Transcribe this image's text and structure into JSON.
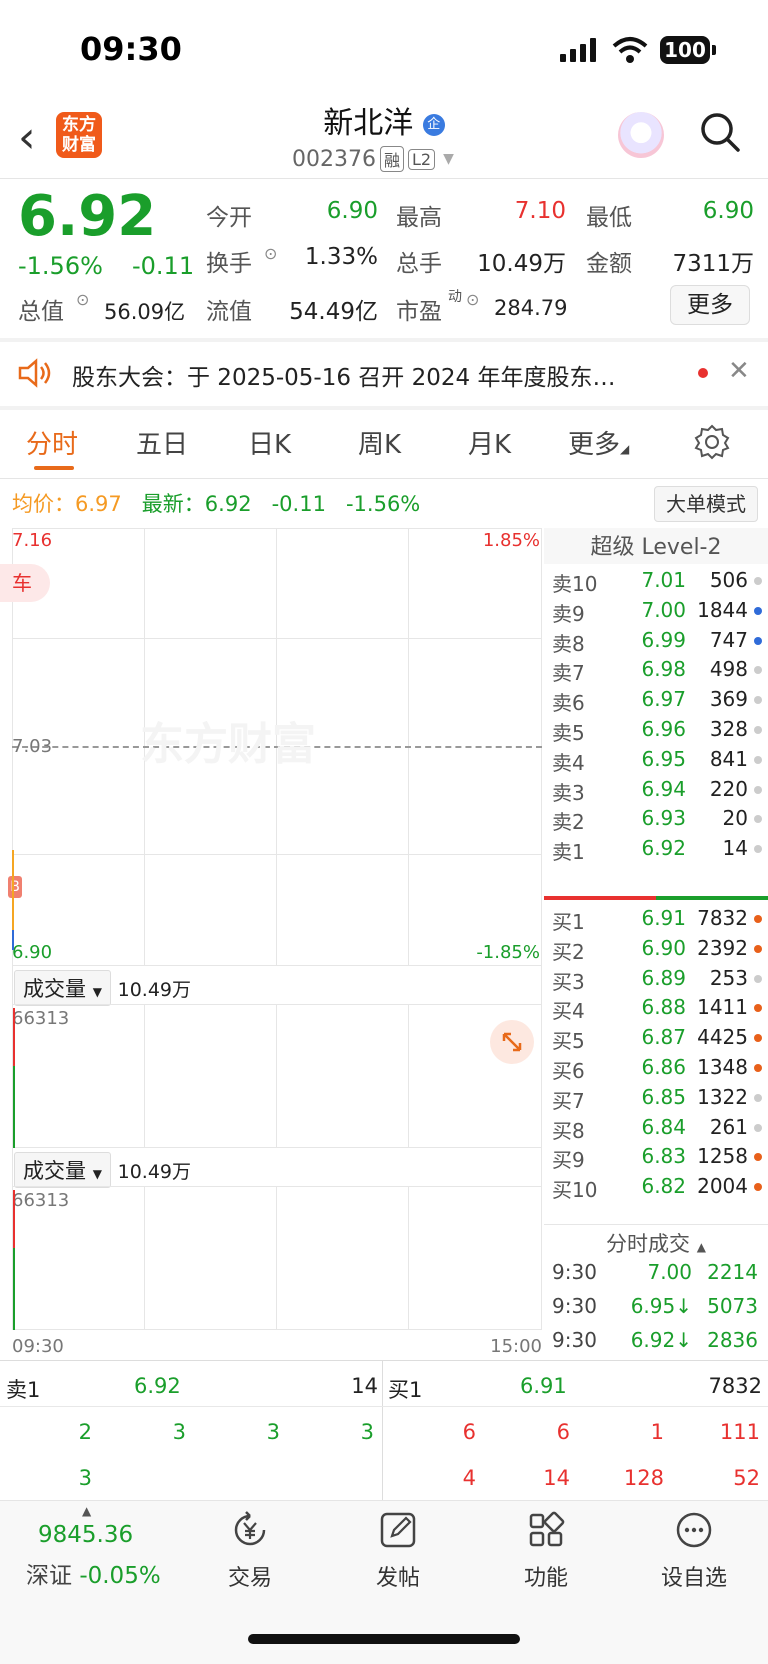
{
  "status_bar": {
    "time": "09:30",
    "battery": "100"
  },
  "header": {
    "logo_text": "东方\n财富",
    "stock_name": "新北洋",
    "name_badge": "企",
    "stock_code": "002376",
    "tags": [
      "融",
      "L2"
    ]
  },
  "quote": {
    "price": "6.92",
    "change_pct": "-1.56%",
    "change_abs": "-0.11",
    "fields": {
      "open_label": "今开",
      "open": "6.90",
      "high_label": "最高",
      "high": "7.10",
      "low_label": "最低",
      "low": "6.90",
      "turnover_label": "换手",
      "turnover": "1.33%",
      "volume_label": "总手",
      "volume": "10.49万",
      "amount_label": "金额",
      "amount": "7311万",
      "mktcap_label": "总值",
      "mktcap": "56.09亿",
      "float_label": "流值",
      "float": "54.49亿",
      "pe_label": "市盈",
      "pe_sup": "动",
      "pe": "284.79"
    },
    "more_button": "更多"
  },
  "notice": {
    "text": "股东大会：于 2025-05-16 召开 2024 年年度股东…"
  },
  "tabs": [
    "分时",
    "五日",
    "日K",
    "周K",
    "月K",
    "更多"
  ],
  "info_line": {
    "avg_label": "均价：",
    "avg": "6.97",
    "latest_label": "最新：",
    "latest": "6.92",
    "latest_abs": "-0.11",
    "latest_pct": "-1.56%",
    "big_order_button": "大单模式"
  },
  "chart": {
    "y_top": "7.16",
    "y_top_pct": "1.85%",
    "y_mid": "7.03",
    "y_bottom": "6.90",
    "y_bottom_pct": "-1.85%",
    "watermark": "东方财富",
    "bubble_text": "车",
    "b_marker": "B",
    "volume_panel_1": {
      "selector": "成交量",
      "value": "10.49万",
      "max": "66313"
    },
    "volume_panel_2": {
      "selector": "成交量",
      "value": "10.49万",
      "max": "66313"
    },
    "x_start": "09:30",
    "x_end": "15:00"
  },
  "order_book": {
    "title": "超级 Level-2",
    "asks": [
      {
        "label": "卖10",
        "price": "7.01",
        "vol": "506",
        "dot": "#cccccc"
      },
      {
        "label": "卖9",
        "price": "7.00",
        "vol": "1844",
        "dot": "#2f6bd8"
      },
      {
        "label": "卖8",
        "price": "6.99",
        "vol": "747",
        "dot": "#2f6bd8"
      },
      {
        "label": "卖7",
        "price": "6.98",
        "vol": "498",
        "dot": "#cccccc"
      },
      {
        "label": "卖6",
        "price": "6.97",
        "vol": "369",
        "dot": "#cccccc"
      },
      {
        "label": "卖5",
        "price": "6.96",
        "vol": "328",
        "dot": "#cccccc"
      },
      {
        "label": "卖4",
        "price": "6.95",
        "vol": "841",
        "dot": "#cccccc"
      },
      {
        "label": "卖3",
        "price": "6.94",
        "vol": "220",
        "dot": "#cccccc"
      },
      {
        "label": "卖2",
        "price": "6.93",
        "vol": "20",
        "dot": "#cccccc"
      },
      {
        "label": "卖1",
        "price": "6.92",
        "vol": "14",
        "dot": "#cccccc"
      }
    ],
    "bids": [
      {
        "label": "买1",
        "price": "6.91",
        "vol": "7832",
        "dot": "#e8601a"
      },
      {
        "label": "买2",
        "price": "6.90",
        "vol": "2392",
        "dot": "#e8601a"
      },
      {
        "label": "买3",
        "price": "6.89",
        "vol": "253",
        "dot": "#cccccc"
      },
      {
        "label": "买4",
        "price": "6.88",
        "vol": "1411",
        "dot": "#e8601a"
      },
      {
        "label": "买5",
        "price": "6.87",
        "vol": "4425",
        "dot": "#e8601a"
      },
      {
        "label": "买6",
        "price": "6.86",
        "vol": "1348",
        "dot": "#e8601a"
      },
      {
        "label": "买7",
        "price": "6.85",
        "vol": "1322",
        "dot": "#cccccc"
      },
      {
        "label": "买8",
        "price": "6.84",
        "vol": "261",
        "dot": "#cccccc"
      },
      {
        "label": "买9",
        "price": "6.83",
        "vol": "1258",
        "dot": "#e8601a"
      },
      {
        "label": "买10",
        "price": "6.82",
        "vol": "2004",
        "dot": "#e8601a"
      }
    ],
    "trades_title": "分时成交",
    "trades": [
      {
        "time": "9:30",
        "price": "7.00",
        "vol": "2214"
      },
      {
        "time": "9:30",
        "price": "6.95↓",
        "vol": "5073"
      },
      {
        "time": "9:30",
        "price": "6.92↓",
        "vol": "2836"
      }
    ]
  },
  "bottom_quote": {
    "sell": {
      "label": "卖1",
      "price": "6.92",
      "vol": "14",
      "row1": [
        "2",
        "3",
        "3",
        "3"
      ],
      "row2": [
        "3"
      ]
    },
    "buy": {
      "label": "买1",
      "price": "6.91",
      "vol": "7832",
      "row1": [
        "6",
        "6",
        "1",
        "111"
      ],
      "row2": [
        "4",
        "14",
        "128",
        "52"
      ]
    }
  },
  "tabbar": {
    "index_value": "9845.36",
    "index_label": "深证",
    "index_change": "-0.05%",
    "items": [
      "交易",
      "发帖",
      "功能",
      "设自选"
    ]
  }
}
